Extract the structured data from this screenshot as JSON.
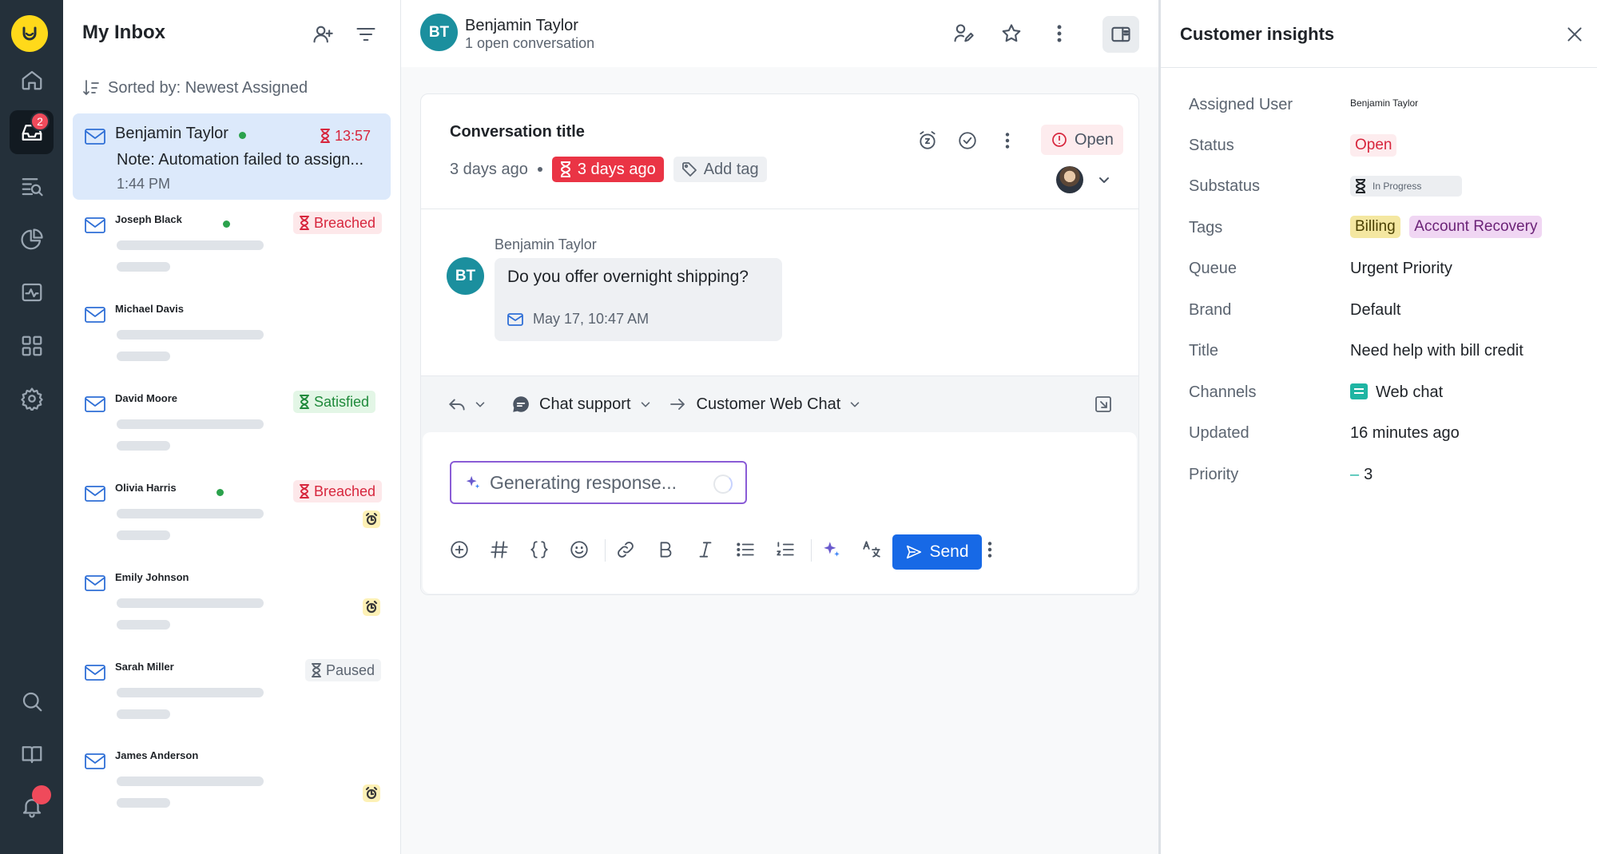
{
  "rail": {
    "inbox_badge": "2",
    "icons": [
      "logo-icon",
      "home-icon",
      "inbox-icon",
      "search-list-icon",
      "reports-icon",
      "activity-icon",
      "apps-icon",
      "settings-icon",
      "search-icon",
      "knowledge-icon",
      "bell-icon"
    ]
  },
  "inbox": {
    "title": "My Inbox",
    "sorted_label": "Sorted by: Newest Assigned",
    "conversations": [
      {
        "name": "Benjamin Taylor",
        "online": true,
        "note": "Note: Automation failed to assign...",
        "time": "1:44 PM",
        "sla": "13:57",
        "sla_type": "red-timer",
        "selected": true
      },
      {
        "name": "Joseph Black",
        "online": true,
        "sla": "Breached",
        "sla_type": "red"
      },
      {
        "name": "Michael Davis",
        "online": false,
        "sla": "",
        "sla_type": "none"
      },
      {
        "name": "David Moore",
        "online": false,
        "sla": "Satisfied",
        "sla_type": "green"
      },
      {
        "name": "Olivia Harris",
        "online": true,
        "sla": "Breached",
        "sla_type": "red",
        "alarm": true
      },
      {
        "name": "Emily Johnson",
        "online": false,
        "sla": "",
        "sla_type": "none",
        "alarm": true
      },
      {
        "name": "Sarah Miller",
        "online": false,
        "sla": "Paused",
        "sla_type": "gray"
      },
      {
        "name": "James Anderson",
        "online": false,
        "sla": "",
        "sla_type": "none",
        "alarm": true
      }
    ]
  },
  "header": {
    "avatar_initials": "BT",
    "name": "Benjamin Taylor",
    "subtitle": "1 open conversation"
  },
  "conversation": {
    "title": "Conversation title",
    "age": "3 days ago",
    "sla": "3 days ago",
    "add_tag": "Add tag",
    "status": "Open",
    "message": {
      "author": "Benjamin Taylor",
      "avatar_initials": "BT",
      "text": "Do you offer overnight shipping?",
      "time": "May 17, 10:47 AM"
    }
  },
  "composer": {
    "channel": "Chat support",
    "destination": "Customer Web Chat",
    "generating": "Generating response...",
    "send_label": "Send"
  },
  "insights": {
    "title": "Customer insights",
    "assigned_user_label": "Assigned User",
    "assigned_user": "Benjamin Taylor",
    "status_label": "Status",
    "status": "Open",
    "substatus_label": "Substatus",
    "substatus": "In Progress",
    "tags_label": "Tags",
    "tags": [
      "Billing",
      "Account Recovery"
    ],
    "queue_label": "Queue",
    "queue": "Urgent Priority",
    "brand_label": "Brand",
    "brand": "Default",
    "title_label": "Title",
    "title_value": "Need help with bill credit",
    "channels_label": "Channels",
    "channel": "Web chat",
    "updated_label": "Updated",
    "updated": "16 minutes ago",
    "priority_label": "Priority",
    "priority_dash": "–",
    "priority": "3"
  },
  "colors": {
    "rail": "#24303a",
    "accent_blue": "#1769e6",
    "breached": "#d7263d",
    "satisfied": "#1f8a3b",
    "teal": "#1b8f9e",
    "ai_purple": "#8a5cd6"
  }
}
